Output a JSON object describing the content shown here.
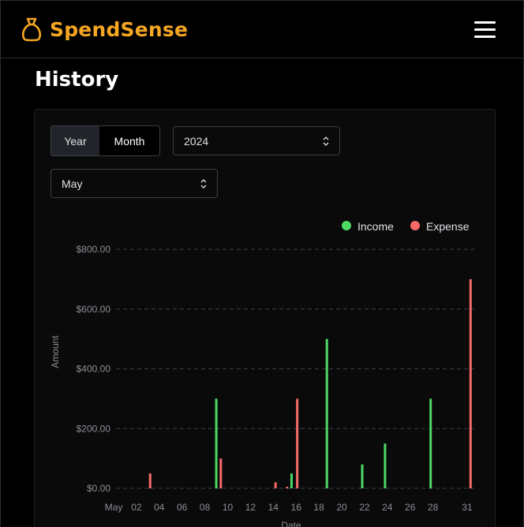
{
  "app": {
    "name": "SpendSense"
  },
  "page": {
    "title": "History"
  },
  "icons": {
    "brand": "money-bag-icon",
    "menu": "hamburger-menu-icon",
    "select_chevron": "chevron-updown-icon"
  },
  "colors": {
    "brand": "#f5a623",
    "income": "#4cd964",
    "expense": "#f76a6a"
  },
  "controls": {
    "period_toggle": {
      "options": [
        "Year",
        "Month"
      ],
      "selected": "Month"
    },
    "year_select": {
      "value": "2024"
    },
    "month_select": {
      "value": "May"
    }
  },
  "chart_data": {
    "type": "bar",
    "xlabel": "Date",
    "ylabel": "Amount",
    "ylim": [
      0,
      800
    ],
    "y_ticks": [
      "$0.00",
      "$200.00",
      "$400.00",
      "$600.00",
      "$800.00"
    ],
    "y_tick_values": [
      0,
      200,
      400,
      600,
      800
    ],
    "x_tick_labels": [
      "May",
      "02",
      "04",
      "06",
      "08",
      "10",
      "12",
      "14",
      "16",
      "18",
      "20",
      "22",
      "24",
      "26",
      "28",
      "31"
    ],
    "x_tick_days": [
      0,
      2,
      4,
      6,
      8,
      10,
      12,
      14,
      16,
      18,
      20,
      22,
      24,
      26,
      28,
      31
    ],
    "grid": "horizontal-dashed",
    "legend_position": "top-right",
    "series": [
      {
        "name": "Income",
        "color": "#4cd964",
        "points": [
          {
            "day": 9,
            "value": 300
          },
          {
            "day": 15.6,
            "value": 50
          },
          {
            "day": 18.7,
            "value": 500
          },
          {
            "day": 21.8,
            "value": 80
          },
          {
            "day": 23.8,
            "value": 150
          },
          {
            "day": 27.8,
            "value": 300
          }
        ]
      },
      {
        "name": "Expense",
        "color": "#f76a6a",
        "points": [
          {
            "day": 3.2,
            "value": 50
          },
          {
            "day": 9.4,
            "value": 100
          },
          {
            "day": 14.2,
            "value": 20
          },
          {
            "day": 15.2,
            "value": 5
          },
          {
            "day": 16.1,
            "value": 300
          },
          {
            "day": 31.3,
            "value": 700
          }
        ]
      }
    ]
  }
}
